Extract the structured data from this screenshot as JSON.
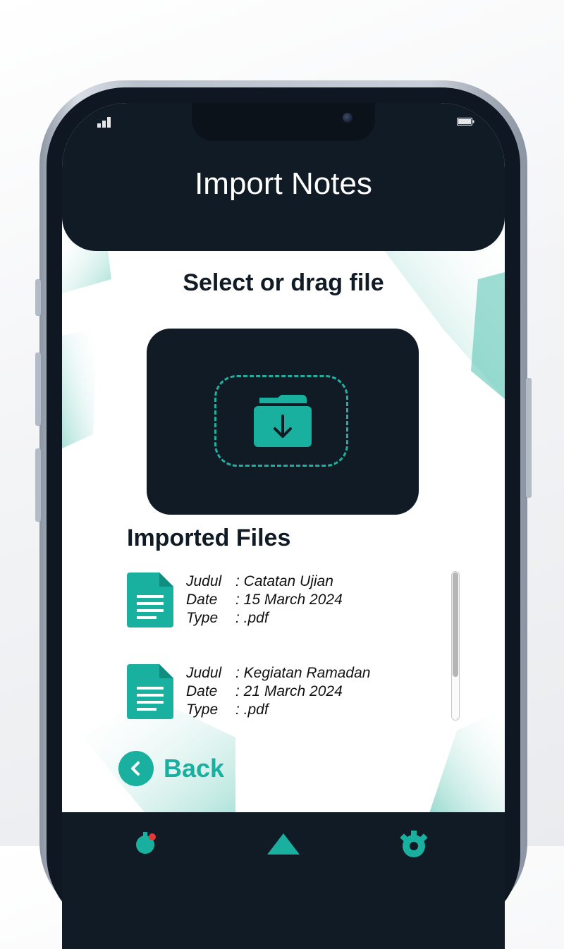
{
  "colors": {
    "dark": "#101b25",
    "accent": "#1ab09f",
    "notification_dot": "#e53935"
  },
  "header": {
    "title": "Import Notes"
  },
  "upload": {
    "heading": "Select or drag file",
    "icon": "folder-download-icon"
  },
  "imported": {
    "title": "Imported Files",
    "files": [
      {
        "icon": "document-icon",
        "judul_label": "Judul",
        "judul": ": Catatan Ujian",
        "date_label": "Date",
        "date": ": 15 March 2024",
        "type_label": "Type",
        "type": ": .pdf"
      },
      {
        "icon": "document-icon",
        "judul_label": "Judul",
        "judul": ": Kegiatan Ramadan",
        "date_label": "Date",
        "date": ": 21 March 2024",
        "type_label": "Type",
        "type": ": .pdf"
      }
    ]
  },
  "back": {
    "label": "Back",
    "icon": "chevron-left-icon"
  },
  "nav": {
    "items": [
      {
        "icon": "notification-icon"
      },
      {
        "icon": "home-icon"
      },
      {
        "icon": "gear-icon"
      }
    ]
  }
}
